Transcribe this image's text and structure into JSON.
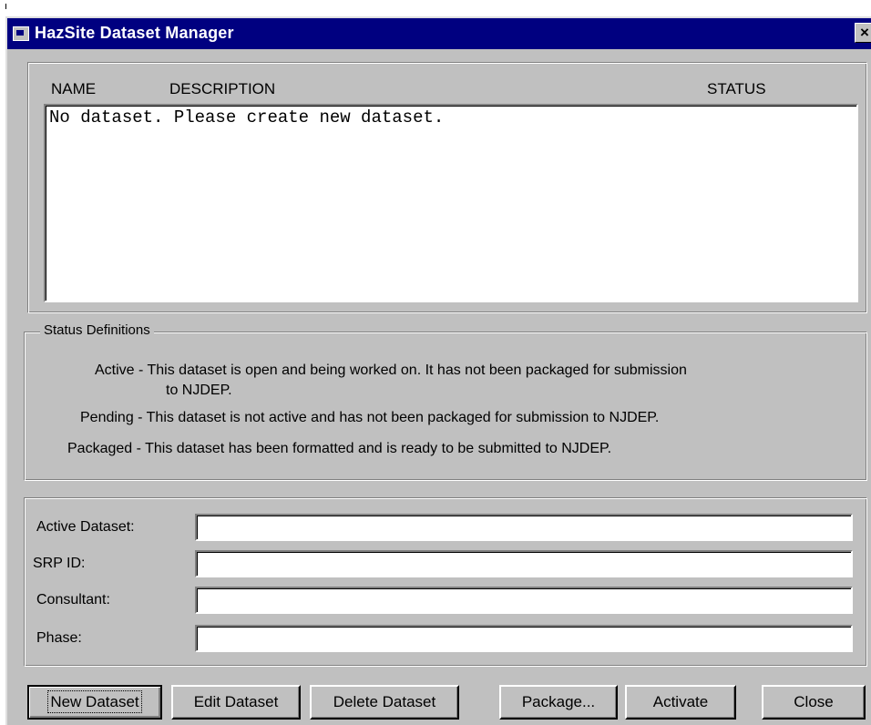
{
  "window": {
    "title": "HazSite Dataset Manager",
    "close_glyph": "×"
  },
  "dataset_list": {
    "columns": [
      "NAME",
      "DESCRIPTION",
      "STATUS"
    ],
    "message": "No dataset. Please create new dataset."
  },
  "status_definitions": {
    "group_label": "Status Definitions",
    "lines": [
      "Active - This dataset is open and being worked on.  It has not been packaged for submission",
      "to NJDEP.",
      "Pending - This dataset is not active and has not been packaged for submission to NJDEP.",
      "Packaged - This dataset has been formatted and is ready to be submitted to NJDEP."
    ]
  },
  "fields": {
    "active_dataset": {
      "label": "Active Dataset:",
      "value": ""
    },
    "srp_id": {
      "label": "SRP ID:",
      "value": ""
    },
    "consultant": {
      "label": "Consultant:",
      "value": ""
    },
    "phase": {
      "label": "Phase:",
      "value": ""
    }
  },
  "buttons": {
    "new_dataset": "New Dataset",
    "edit_dataset": "Edit Dataset",
    "delete_dataset": "Delete Dataset",
    "package": "Package...",
    "activate": "Activate",
    "close": "Close"
  }
}
